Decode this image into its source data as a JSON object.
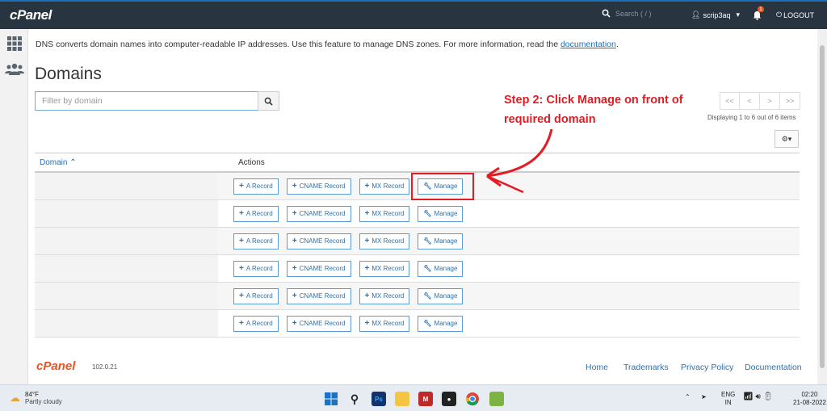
{
  "header": {
    "logo": "cPanel",
    "search_placeholder": "Search ( / )",
    "username": "scrip3aq",
    "notification_count": "1",
    "logout_label": "LOGOUT"
  },
  "intro": {
    "text": "DNS converts domain names into computer-readable IP addresses. Use this feature to manage DNS zones. For more information, read the ",
    "link": "documentation",
    "suffix": "."
  },
  "page_title": "Domains",
  "filter": {
    "placeholder": "Filter by domain"
  },
  "annotation": {
    "line1": "Step 2: Click Manage on front of",
    "line2": "required domain",
    "color": "#e31b23"
  },
  "pagination": {
    "first": "<<",
    "prev": "<",
    "next": ">",
    "last": ">>",
    "info": "Displaying 1 to 6 out of 6 items"
  },
  "table": {
    "col_domain": "Domain",
    "col_actions": "Actions",
    "actions": [
      "A Record",
      "CNAME Record",
      "MX Record",
      "Manage"
    ],
    "row_count": 6
  },
  "footer": {
    "logo": "cPanel",
    "version": "102.0.21",
    "links": [
      "Home",
      "Trademarks",
      "Privacy Policy",
      "Documentation"
    ]
  },
  "taskbar": {
    "temp": "84°F",
    "weather": "Partly cloudy",
    "lang1": "ENG",
    "lang2": "IN",
    "time": "02:20",
    "date": "21-08-2022"
  }
}
